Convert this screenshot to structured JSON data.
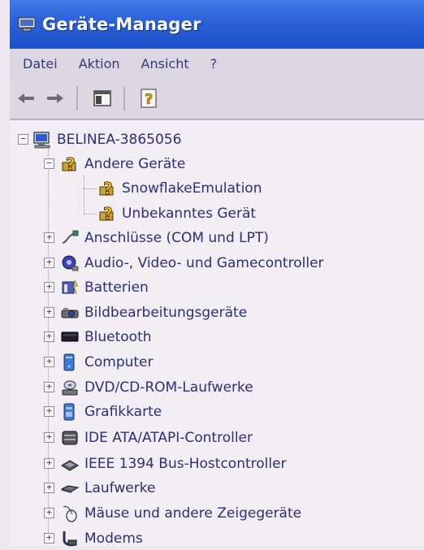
{
  "window": {
    "title": "Geräte-Manager"
  },
  "menu": {
    "items": [
      "Datei",
      "Aktion",
      "Ansicht",
      "?"
    ]
  },
  "tree": {
    "root": "BELINEA-3865056",
    "open_category": {
      "label": "Andere Geräte",
      "children": [
        "SnowflakeEmulation",
        "Unbekanntes Gerät"
      ]
    },
    "categories": [
      "Anschlüsse (COM und LPT)",
      "Audio-, Video- und Gamecontroller",
      "Batterien",
      "Bildbearbeitungsgeräte",
      "Bluetooth",
      "Computer",
      "DVD/CD-ROM-Laufwerke",
      "Grafikkarte",
      "IDE ATA/ATAPI-Controller",
      "IEEE 1394 Bus-Hostcontroller",
      "Laufwerke",
      "Mäuse und andere Zeigegeräte",
      "Modems"
    ]
  },
  "icons": {
    "titlebar": "device-manager-icon",
    "toolbar": [
      "back-arrow-icon",
      "forward-arrow-icon",
      "show-hide-console-tree-icon",
      "properties-help-icon"
    ],
    "root": "computer-icon",
    "open_category": "unknown-device-icon",
    "children": [
      "unknown-device-icon",
      "unknown-device-icon"
    ],
    "categories": [
      "port-icon",
      "audio-icon",
      "battery-icon",
      "imaging-device-icon",
      "bluetooth-icon",
      "computer-icon",
      "optical-drive-icon",
      "display-adapter-icon",
      "ide-controller-icon",
      "firewire-controller-icon",
      "disk-drive-icon",
      "mouse-icon",
      "modem-icon"
    ]
  },
  "colors": {
    "title_bar": "#2a60d8",
    "tree_text": "#2b2f7a",
    "background": "#ede7ef"
  }
}
